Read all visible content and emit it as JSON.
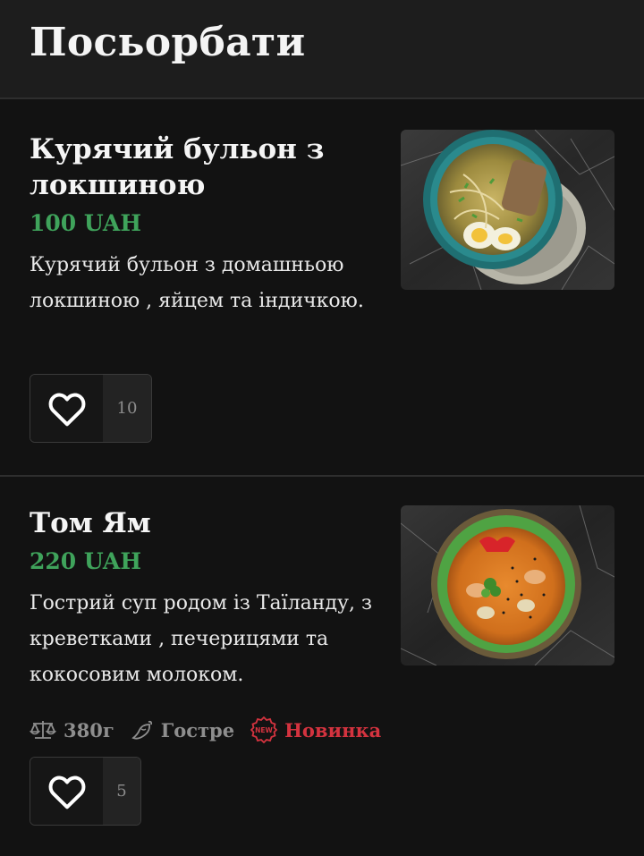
{
  "header": {
    "title": "Посьорбати"
  },
  "items": [
    {
      "title": "Курячий бульон з локшиною",
      "price": "100 UAH",
      "description": "Курячий бульон з домашньою локшиною , яйцем та індичкою.",
      "likes": "10",
      "photo_icon": "chicken-noodle-soup-photo"
    },
    {
      "title": "Том Ям",
      "price": "220 UAH",
      "description": "Гострий суп родом із Таїланду, з креветками , печерицями та кокосовим молоком.",
      "weight": "380г",
      "spicy_label": "Гостре",
      "new_label": "Новинка",
      "likes": "5",
      "photo_icon": "tom-yum-soup-photo"
    }
  ],
  "colors": {
    "background": "#121212",
    "header_bg": "#1d1d1d",
    "price": "#3fa35b",
    "new_badge": "#d4333f",
    "muted": "#8e8e8e"
  }
}
